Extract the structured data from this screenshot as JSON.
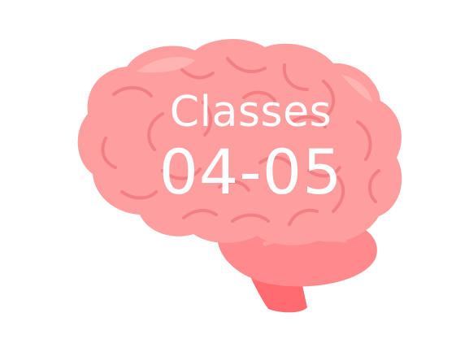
{
  "illustration": {
    "icon": "brain-icon",
    "colors": {
      "brain_main": "#FF9E9E",
      "brain_fold": "#F27F84",
      "brain_highlight": "#FFB3B3",
      "cerebellum": "#FF8A8E",
      "brainstem": "#FF6B6E",
      "text": "#FFFFFF",
      "background": "#FFFFFF"
    }
  },
  "title": {
    "line1": "Classes",
    "line2": "04-05"
  }
}
